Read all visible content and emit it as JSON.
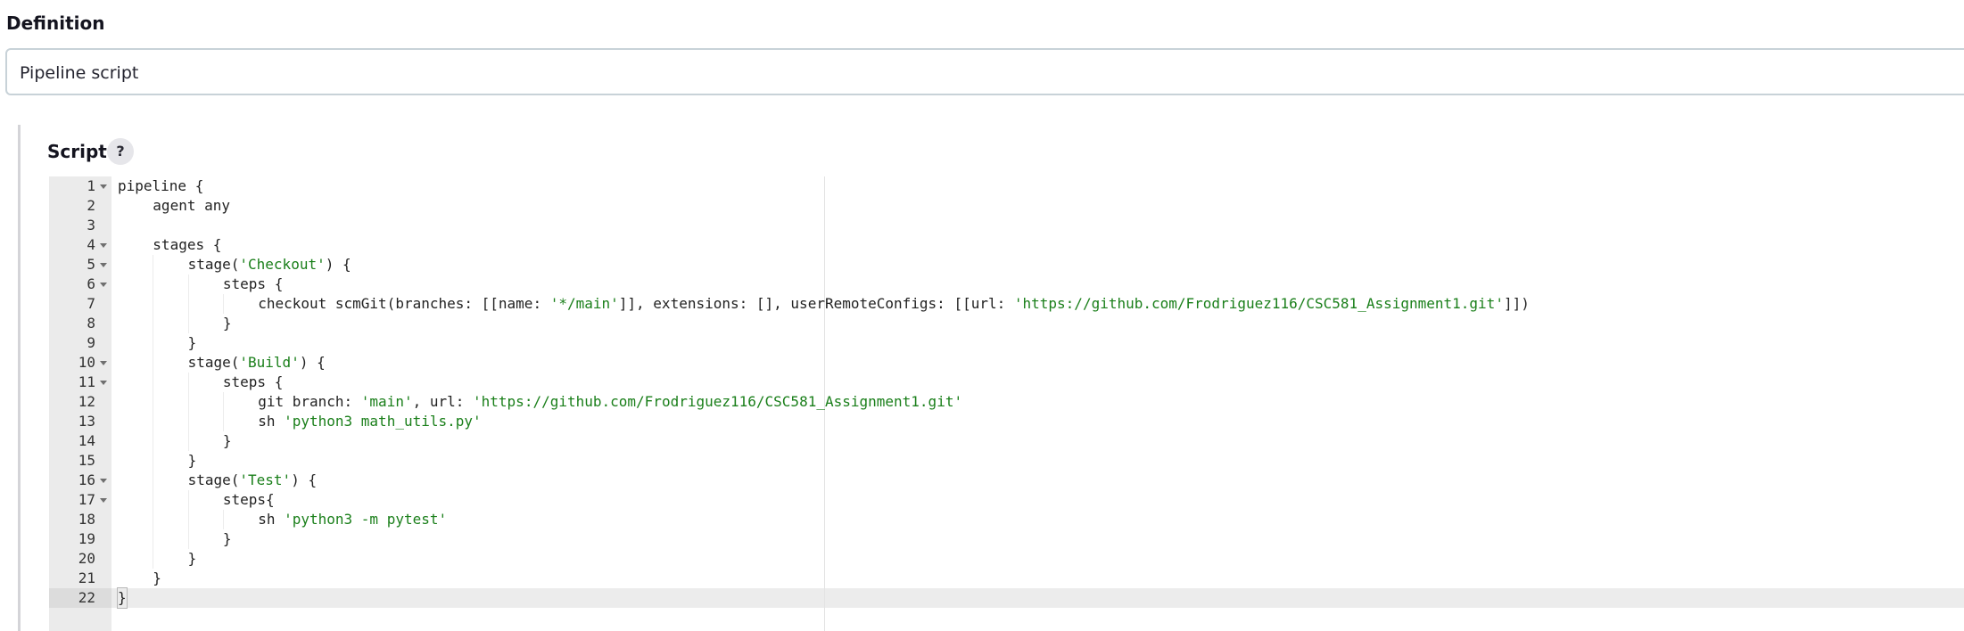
{
  "definition": {
    "label": "Definition",
    "selected_value": "Pipeline script"
  },
  "script": {
    "label": "Script",
    "help_label": "?"
  },
  "editor": {
    "active_line": 22,
    "lines": [
      {
        "number": "1",
        "foldable": true,
        "indent": 0,
        "segments": [
          [
            "code",
            "pipeline "
          ],
          [
            "code",
            "{"
          ]
        ]
      },
      {
        "number": "2",
        "foldable": false,
        "indent": 1,
        "segments": [
          [
            "code",
            "agent any"
          ]
        ]
      },
      {
        "number": "3",
        "foldable": false,
        "indent": 0,
        "segments": []
      },
      {
        "number": "4",
        "foldable": true,
        "indent": 1,
        "segments": [
          [
            "code",
            "stages {"
          ]
        ]
      },
      {
        "number": "5",
        "foldable": true,
        "indent": 2,
        "segments": [
          [
            "code",
            "stage("
          ],
          [
            "str",
            "'Checkout'"
          ],
          [
            "code",
            ") {"
          ]
        ]
      },
      {
        "number": "6",
        "foldable": true,
        "indent": 3,
        "segments": [
          [
            "code",
            "steps {"
          ]
        ]
      },
      {
        "number": "7",
        "foldable": false,
        "indent": 4,
        "segments": [
          [
            "code",
            "checkout scmGit(branches: [[name: "
          ],
          [
            "str",
            "'*/main'"
          ],
          [
            "code",
            "]], extensions: [], userRemoteConfigs: [[url: "
          ],
          [
            "str",
            "'https://github.com/Frodriguez116/CSC581_Assignment1.git'"
          ],
          [
            "code",
            "]])"
          ]
        ]
      },
      {
        "number": "8",
        "foldable": false,
        "indent": 3,
        "segments": [
          [
            "code",
            "}"
          ]
        ]
      },
      {
        "number": "9",
        "foldable": false,
        "indent": 2,
        "segments": [
          [
            "code",
            "}"
          ]
        ]
      },
      {
        "number": "10",
        "foldable": true,
        "indent": 2,
        "segments": [
          [
            "code",
            "stage("
          ],
          [
            "str",
            "'Build'"
          ],
          [
            "code",
            ") {"
          ]
        ]
      },
      {
        "number": "11",
        "foldable": true,
        "indent": 3,
        "segments": [
          [
            "code",
            "steps {"
          ]
        ]
      },
      {
        "number": "12",
        "foldable": false,
        "indent": 4,
        "segments": [
          [
            "code",
            "git branch: "
          ],
          [
            "str",
            "'main'"
          ],
          [
            "code",
            ", url: "
          ],
          [
            "str",
            "'https://github.com/Frodriguez116/CSC581_Assignment1.git'"
          ]
        ]
      },
      {
        "number": "13",
        "foldable": false,
        "indent": 4,
        "segments": [
          [
            "code",
            "sh "
          ],
          [
            "str",
            "'python3 math_utils.py'"
          ]
        ]
      },
      {
        "number": "14",
        "foldable": false,
        "indent": 3,
        "segments": [
          [
            "code",
            "}"
          ]
        ]
      },
      {
        "number": "15",
        "foldable": false,
        "indent": 2,
        "segments": [
          [
            "code",
            "}"
          ]
        ]
      },
      {
        "number": "16",
        "foldable": true,
        "indent": 2,
        "segments": [
          [
            "code",
            "stage("
          ],
          [
            "str",
            "'Test'"
          ],
          [
            "code",
            ") {"
          ]
        ]
      },
      {
        "number": "17",
        "foldable": true,
        "indent": 3,
        "segments": [
          [
            "code",
            "steps{"
          ]
        ]
      },
      {
        "number": "18",
        "foldable": false,
        "indent": 4,
        "segments": [
          [
            "code",
            "sh "
          ],
          [
            "str",
            "'python3 -m pytest'"
          ]
        ]
      },
      {
        "number": "19",
        "foldable": false,
        "indent": 3,
        "segments": [
          [
            "code",
            "}"
          ]
        ]
      },
      {
        "number": "20",
        "foldable": false,
        "indent": 2,
        "segments": [
          [
            "code",
            "}"
          ]
        ]
      },
      {
        "number": "21",
        "foldable": false,
        "indent": 1,
        "segments": [
          [
            "code",
            "}"
          ]
        ]
      },
      {
        "number": "22",
        "foldable": false,
        "indent": 0,
        "segments": [
          [
            "code",
            "}"
          ]
        ]
      }
    ]
  }
}
